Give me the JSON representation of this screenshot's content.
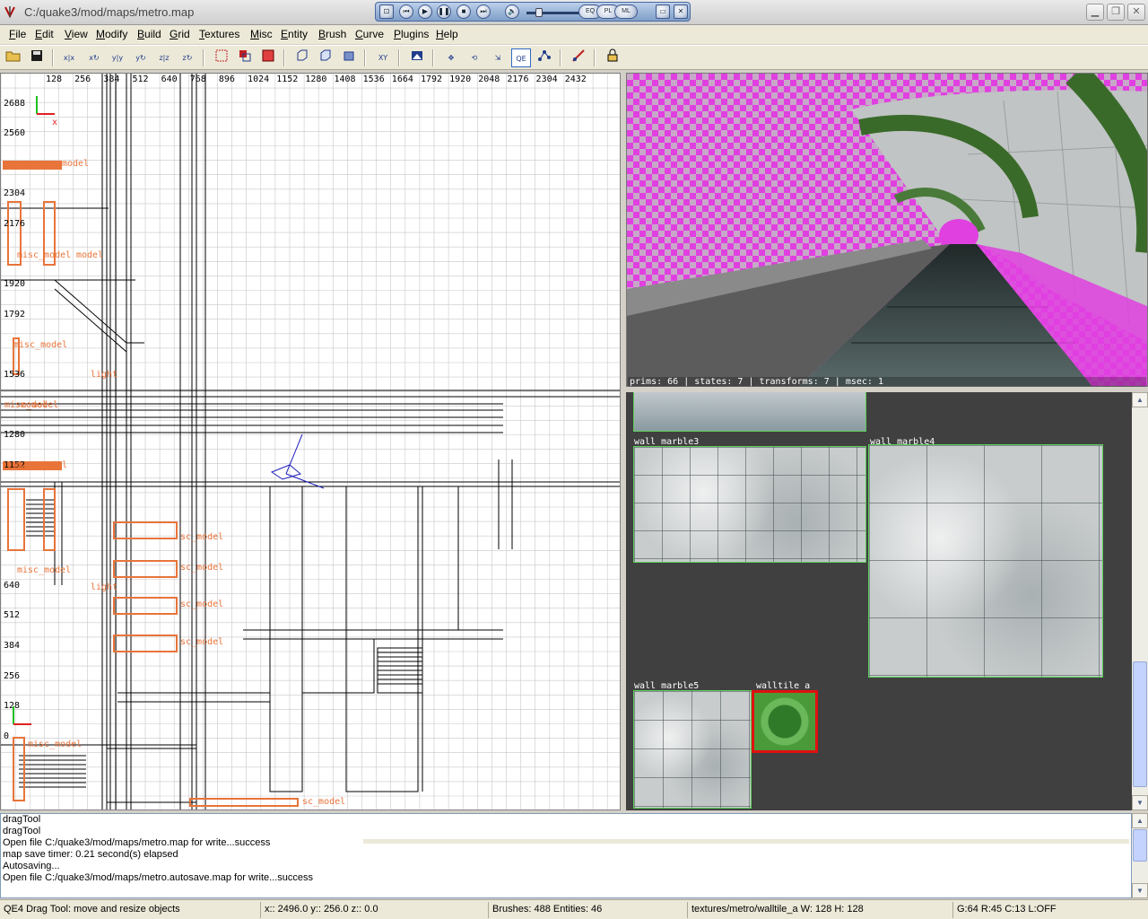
{
  "window": {
    "title": "C:/quake3/mod/maps/metro.map"
  },
  "media_bar": {
    "buttons": [
      "prev",
      "play",
      "pause",
      "stop",
      "next",
      "mute"
    ],
    "pill_labels": [
      "EQ",
      "PL",
      "ML"
    ]
  },
  "menu": [
    {
      "label": "File",
      "u": "F"
    },
    {
      "label": "Edit",
      "u": "E"
    },
    {
      "label": "View",
      "u": "V"
    },
    {
      "label": "Modify",
      "u": "M"
    },
    {
      "label": "Build",
      "u": "B"
    },
    {
      "label": "Grid",
      "u": "G"
    },
    {
      "label": "Textures",
      "u": "T"
    },
    {
      "label": "Misc",
      "u": "M"
    },
    {
      "label": "Entity",
      "u": "E"
    },
    {
      "label": "Brush",
      "u": "B"
    },
    {
      "label": "Curve",
      "u": "C"
    },
    {
      "label": "Plugins",
      "u": "P"
    },
    {
      "label": "Help",
      "u": "H"
    }
  ],
  "toolbar": {
    "qe_label": "QE",
    "xy_label": "XY"
  },
  "grid_view": {
    "x_ticks": [
      "128",
      "256",
      "384",
      "512",
      "640",
      "768",
      "896",
      "1024",
      "1152",
      "1280",
      "1408",
      "1536",
      "1664",
      "1792",
      "1920",
      "2048",
      "2176",
      "2304",
      "2432"
    ],
    "y_ticks": [
      "2688",
      "2560",
      "2304",
      "2176",
      "1920",
      "1792",
      "1536",
      "1280",
      "1152",
      "640",
      "512",
      "384",
      "256",
      "128",
      "0"
    ],
    "axis_x": "x",
    "entity_labels": [
      "model",
      "misc_model",
      "model",
      "light",
      "misc_model",
      "model",
      "misc_model",
      "misc_model",
      "misc_model",
      "light",
      "sc_model",
      "sc_model",
      "sc_model",
      "sc_model",
      "misc_model",
      "sc_model"
    ]
  },
  "camera": {
    "stats": "prims: 66 | states: 7 | transforms: 7 | msec: 1"
  },
  "texture_browser": {
    "textures": [
      {
        "name": "wall_marble3"
      },
      {
        "name": "wall_marble4"
      },
      {
        "name": "wall_marble5"
      },
      {
        "name": "walltile_a",
        "selected": true
      }
    ]
  },
  "console": {
    "lines": [
      "dragTool",
      "dragTool",
      "Open file C:/quake3/mod/maps/metro.map for write...success",
      "map save timer:  0.21 second(s) elapsed",
      "Autosaving...",
      "Open file C:/quake3/mod/maps/metro.autosave.map for write...success"
    ]
  },
  "status": {
    "tool": "QE4 Drag Tool: move and resize objects",
    "coords": "x:: 2496.0  y:: 256.0  z::    0.0",
    "counts": "Brushes: 488 Entities: 46",
    "texture": "textures/metro/walltile_a W: 128 H: 128",
    "grid": "G:64 R:45 C:13 L:OFF"
  },
  "colors": {
    "entity": "#e8743a",
    "grid_minor": "#c8c8c8",
    "brush": "#000000",
    "selected_texture": "#e01010",
    "texture_border": "#5ad05a",
    "tunnel_magenta": "#e040e0"
  }
}
